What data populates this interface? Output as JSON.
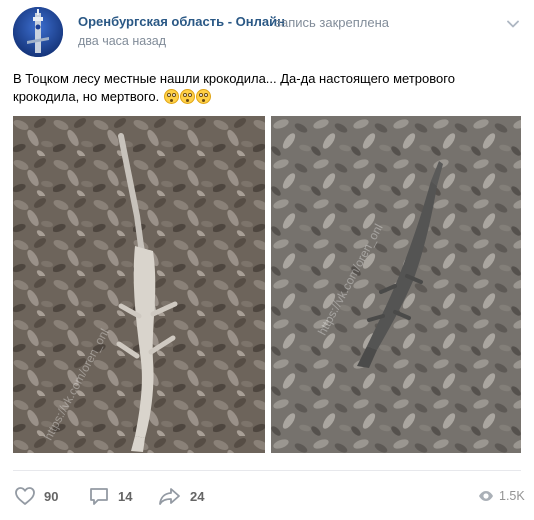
{
  "header": {
    "community_name": "Оренбургская область - Онлайн",
    "pinned_label": "запись закреплена",
    "time": "два часа назад",
    "menu_icon": "chevron-down-icon"
  },
  "post": {
    "text": "В Тоцком лесу местные нашли крокодила... Да-да настоящего метрового крокодила, но мертвого.",
    "emojis": [
      "flushed-face",
      "flushed-face",
      "flushed-face"
    ]
  },
  "photos": [
    {
      "name": "photo-crocodile-belly-up",
      "watermark": "https://vk.com/oren_onl"
    },
    {
      "name": "photo-crocodile-side",
      "watermark": "https://vk.com/oren_onl"
    }
  ],
  "footer": {
    "likes": "90",
    "comments": "14",
    "shares": "24",
    "views": "1.5K"
  },
  "colors": {
    "link": "#2a5885",
    "meta": "#818c99",
    "icon": "#939aa3",
    "count": "#656565"
  }
}
